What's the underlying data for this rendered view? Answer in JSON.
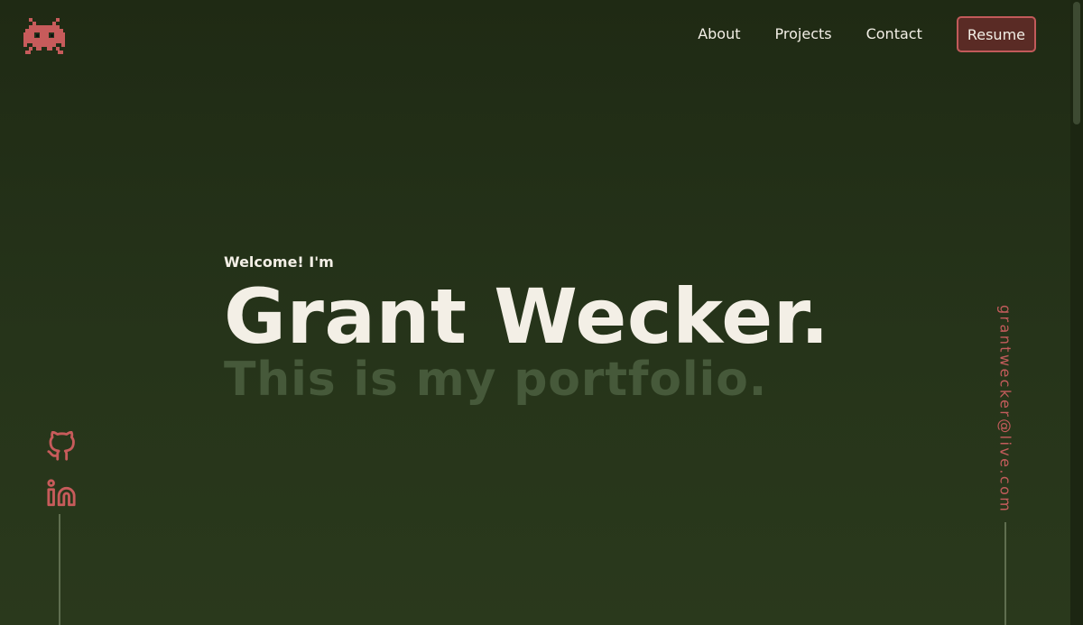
{
  "logo": {
    "icon": "space-invader-icon",
    "color": "#c75b5b"
  },
  "nav": {
    "items": [
      {
        "label": "About"
      },
      {
        "label": "Projects"
      },
      {
        "label": "Contact"
      }
    ],
    "resume_label": "Resume"
  },
  "hero": {
    "welcome": "Welcome! I'm",
    "name": "Grant Wecker.",
    "tagline": "This is my portfolio."
  },
  "social": {
    "items": [
      {
        "icon": "github-icon"
      },
      {
        "icon": "linkedin-icon"
      }
    ]
  },
  "email": "grantwecker@live.com",
  "colors": {
    "background": "#23301a",
    "text": "#f3efe6",
    "muted_text": "#46593a",
    "accent": "#c75b5b",
    "button_bg": "#5a2b25"
  }
}
